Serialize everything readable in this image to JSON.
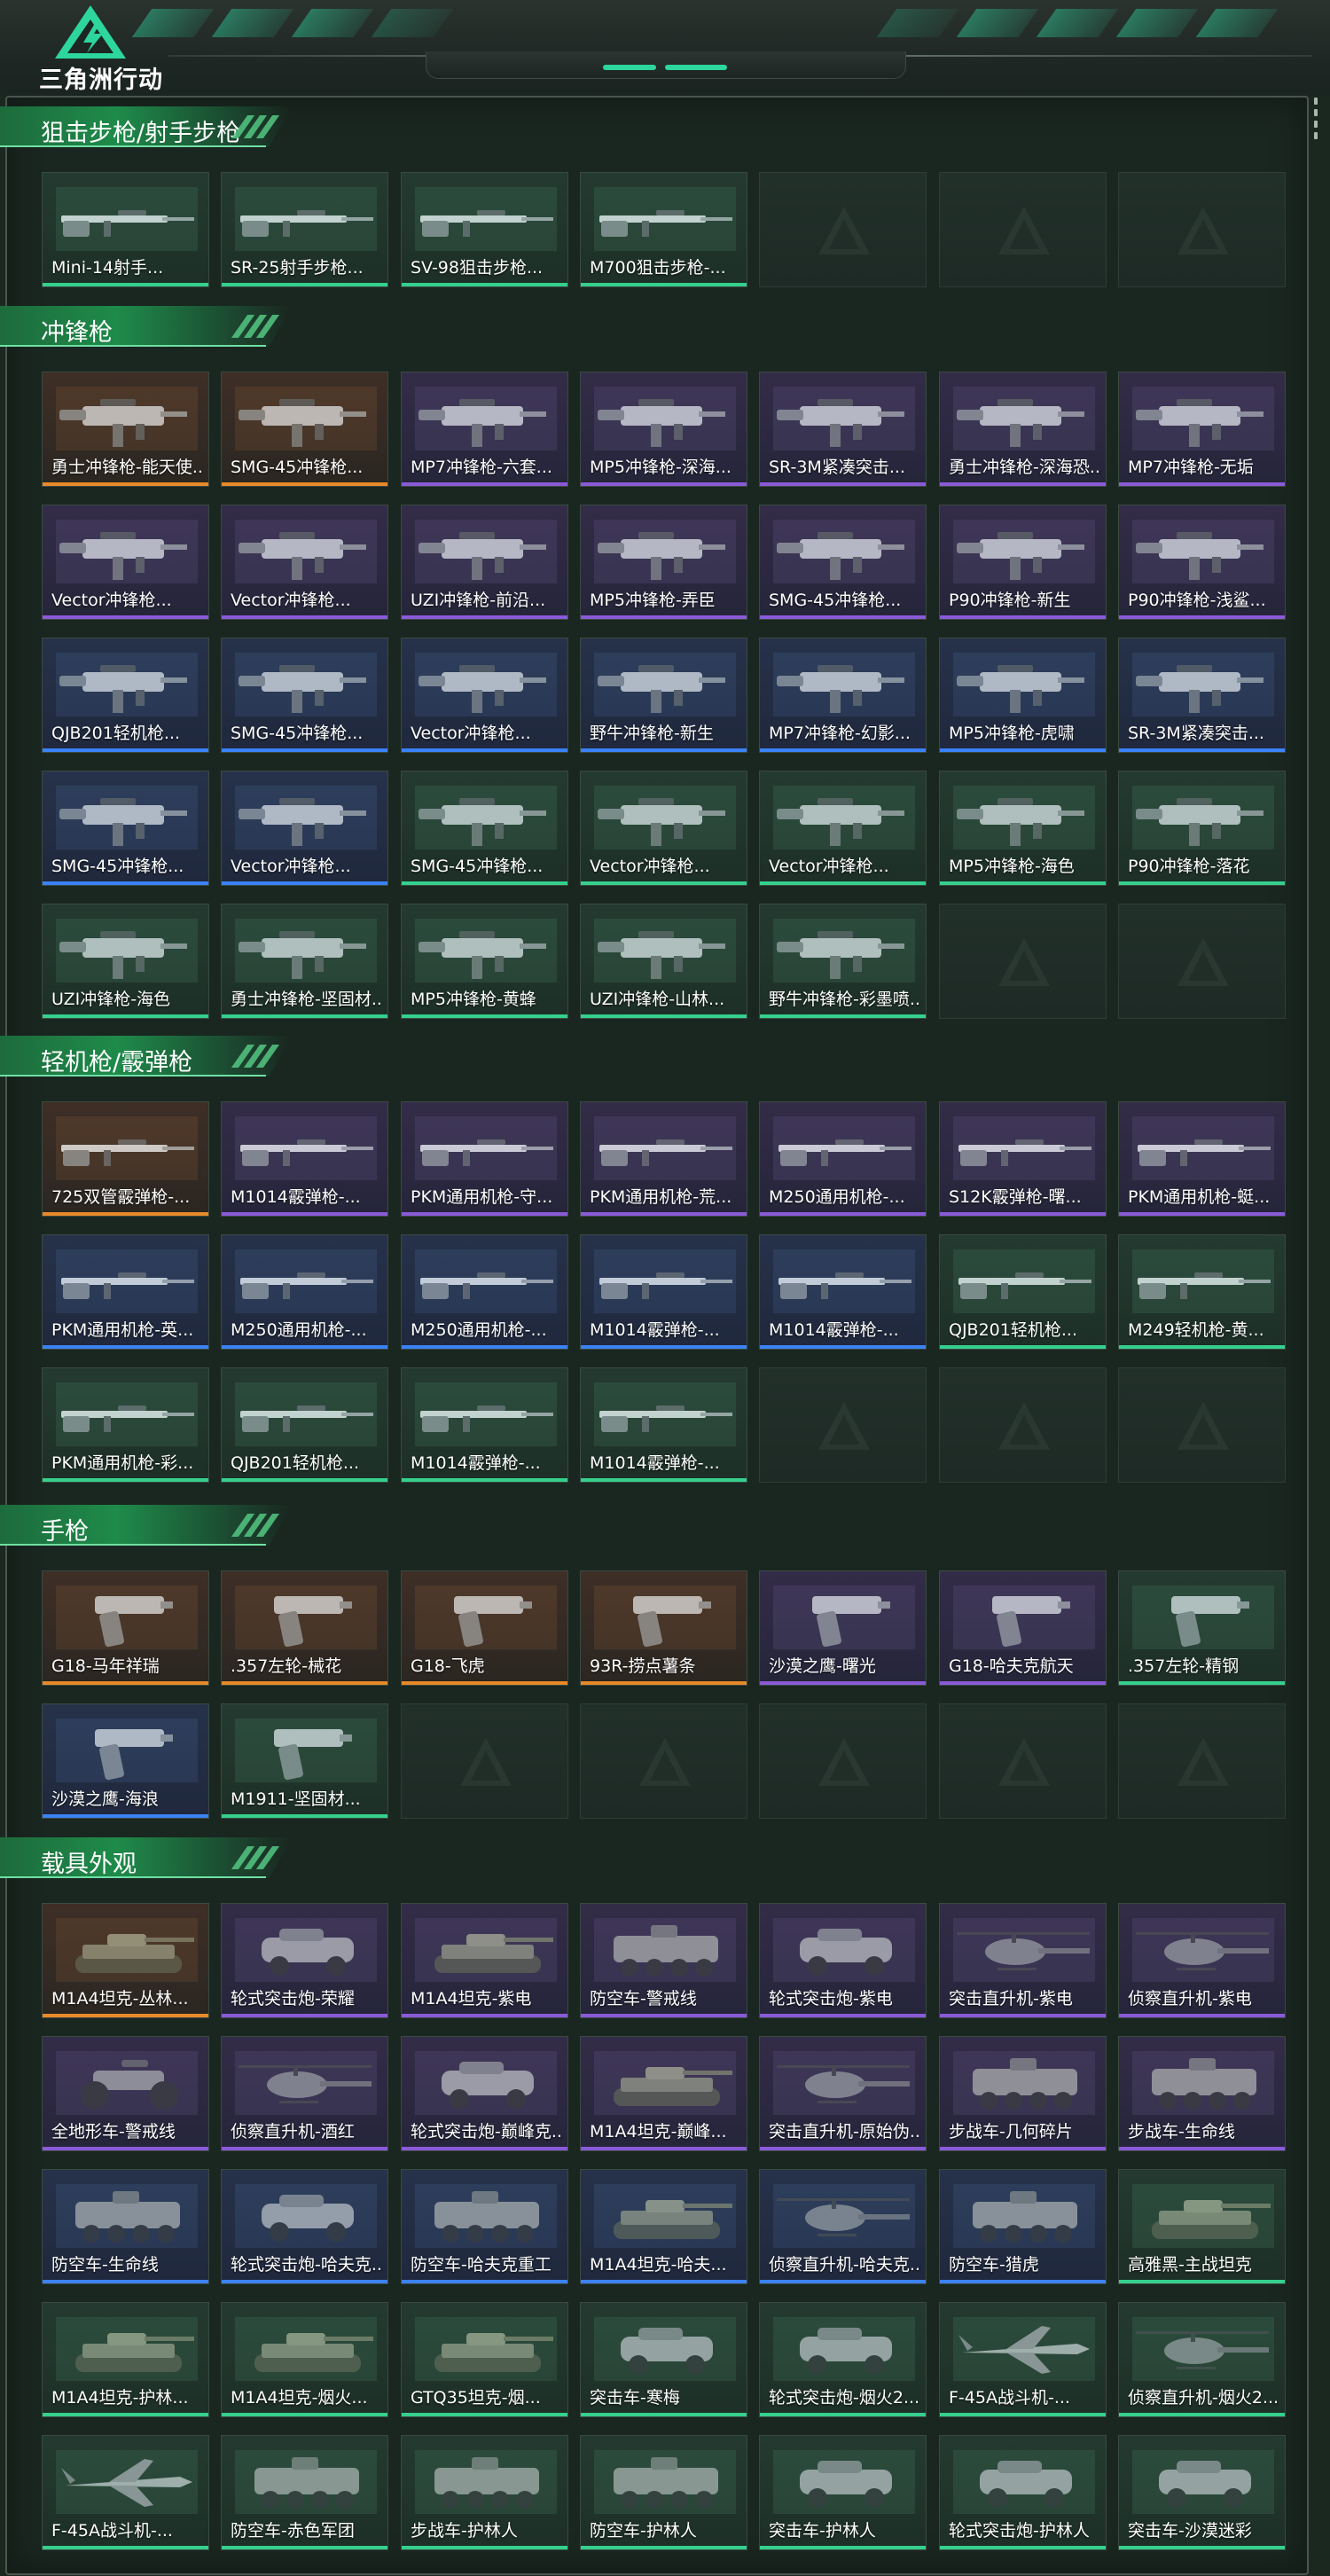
{
  "header": {
    "game_logo_text": "三角洲行动",
    "accent_color": "#2dd69d"
  },
  "rarity_colors": {
    "orange": "#e88a2a",
    "purple": "#8a5ad8",
    "blue": "#3b82f6",
    "green": "#35d08e"
  },
  "sections": [
    {
      "title": "狙击步枪/射手步枪",
      "items": [
        {
          "name": "Mini-14射手...",
          "rarity": "green",
          "type": "rifle"
        },
        {
          "name": "SR-25射手步枪...",
          "rarity": "green",
          "type": "rifle"
        },
        {
          "name": "SV-98狙击步枪...",
          "rarity": "green",
          "type": "rifle"
        },
        {
          "name": "M700狙击步枪-...",
          "rarity": "green",
          "type": "rifle"
        }
      ],
      "empty_slots": 3
    },
    {
      "title": "冲锋枪",
      "items": [
        {
          "name": "勇士冲锋枪-能天使...",
          "rarity": "orange",
          "type": "smg"
        },
        {
          "name": "SMG-45冲锋枪...",
          "rarity": "orange",
          "type": "smg"
        },
        {
          "name": "MP7冲锋枪-六套...",
          "rarity": "purple",
          "type": "smg"
        },
        {
          "name": "MP5冲锋枪-深海...",
          "rarity": "purple",
          "type": "smg"
        },
        {
          "name": "SR-3M紧凑突击...",
          "rarity": "purple",
          "type": "smg"
        },
        {
          "name": "勇士冲锋枪-深海恐...",
          "rarity": "purple",
          "type": "smg"
        },
        {
          "name": "MP7冲锋枪-无垢",
          "rarity": "purple",
          "type": "smg"
        },
        {
          "name": "Vector冲锋枪...",
          "rarity": "purple",
          "type": "smg"
        },
        {
          "name": "Vector冲锋枪...",
          "rarity": "purple",
          "type": "smg"
        },
        {
          "name": "UZI冲锋枪-前沿...",
          "rarity": "purple",
          "type": "smg"
        },
        {
          "name": "MP5冲锋枪-弄臣",
          "rarity": "purple",
          "type": "smg"
        },
        {
          "name": "SMG-45冲锋枪...",
          "rarity": "purple",
          "type": "smg"
        },
        {
          "name": "P90冲锋枪-新生",
          "rarity": "purple",
          "type": "smg"
        },
        {
          "name": "P90冲锋枪-浅鲨...",
          "rarity": "purple",
          "type": "smg"
        },
        {
          "name": "QJB201轻机枪...",
          "rarity": "blue",
          "type": "smg"
        },
        {
          "name": "SMG-45冲锋枪...",
          "rarity": "blue",
          "type": "smg"
        },
        {
          "name": "Vector冲锋枪...",
          "rarity": "blue",
          "type": "smg"
        },
        {
          "name": "野牛冲锋枪-新生",
          "rarity": "blue",
          "type": "smg"
        },
        {
          "name": "MP7冲锋枪-幻影...",
          "rarity": "blue",
          "type": "smg"
        },
        {
          "name": "MP5冲锋枪-虎啸",
          "rarity": "blue",
          "type": "smg"
        },
        {
          "name": "SR-3M紧凑突击...",
          "rarity": "blue",
          "type": "smg"
        },
        {
          "name": "SMG-45冲锋枪...",
          "rarity": "blue",
          "type": "smg"
        },
        {
          "name": "Vector冲锋枪...",
          "rarity": "blue",
          "type": "smg"
        },
        {
          "name": "SMG-45冲锋枪...",
          "rarity": "green",
          "type": "smg"
        },
        {
          "name": "Vector冲锋枪...",
          "rarity": "green",
          "type": "smg"
        },
        {
          "name": "Vector冲锋枪...",
          "rarity": "green",
          "type": "smg"
        },
        {
          "name": "MP5冲锋枪-海色",
          "rarity": "green",
          "type": "smg"
        },
        {
          "name": "P90冲锋枪-落花",
          "rarity": "green",
          "type": "smg"
        },
        {
          "name": "UZI冲锋枪-海色",
          "rarity": "green",
          "type": "smg"
        },
        {
          "name": "勇士冲锋枪-坚固材...",
          "rarity": "green",
          "type": "smg"
        },
        {
          "name": "MP5冲锋枪-黄蜂",
          "rarity": "green",
          "type": "smg"
        },
        {
          "name": "UZI冲锋枪-山林...",
          "rarity": "green",
          "type": "smg"
        },
        {
          "name": "野牛冲锋枪-彩墨喷...",
          "rarity": "green",
          "type": "smg"
        }
      ],
      "empty_slots": 2
    },
    {
      "title": "轻机枪/霰弹枪",
      "items": [
        {
          "name": "725双管霰弹枪-...",
          "rarity": "orange",
          "type": "rifle"
        },
        {
          "name": "M1014霰弹枪-...",
          "rarity": "purple",
          "type": "rifle"
        },
        {
          "name": "PKM通用机枪-守...",
          "rarity": "purple",
          "type": "rifle"
        },
        {
          "name": "PKM通用机枪-荒...",
          "rarity": "purple",
          "type": "rifle"
        },
        {
          "name": "M250通用机枪-...",
          "rarity": "purple",
          "type": "rifle"
        },
        {
          "name": "S12K霰弹枪-曙...",
          "rarity": "purple",
          "type": "rifle"
        },
        {
          "name": "PKM通用机枪-蜓...",
          "rarity": "purple",
          "type": "rifle"
        },
        {
          "name": "PKM通用机枪-英...",
          "rarity": "blue",
          "type": "rifle"
        },
        {
          "name": "M250通用机枪-...",
          "rarity": "blue",
          "type": "rifle"
        },
        {
          "name": "M250通用机枪-...",
          "rarity": "blue",
          "type": "rifle"
        },
        {
          "name": "M1014霰弹枪-...",
          "rarity": "blue",
          "type": "rifle"
        },
        {
          "name": "M1014霰弹枪-...",
          "rarity": "blue",
          "type": "rifle"
        },
        {
          "name": "QJB201轻机枪...",
          "rarity": "green",
          "type": "rifle"
        },
        {
          "name": "M249轻机枪-黄...",
          "rarity": "green",
          "type": "rifle"
        },
        {
          "name": "PKM通用机枪-彩...",
          "rarity": "green",
          "type": "rifle"
        },
        {
          "name": "QJB201轻机枪...",
          "rarity": "green",
          "type": "rifle"
        },
        {
          "name": "M1014霰弹枪-...",
          "rarity": "green",
          "type": "rifle"
        },
        {
          "name": "M1014霰弹枪-...",
          "rarity": "green",
          "type": "rifle"
        }
      ],
      "empty_slots": 3
    },
    {
      "title": "手枪",
      "items": [
        {
          "name": "G18-马年祥瑞",
          "rarity": "orange",
          "type": "pistol"
        },
        {
          "name": ".357左轮-械花",
          "rarity": "orange",
          "type": "pistol"
        },
        {
          "name": "G18-飞虎",
          "rarity": "orange",
          "type": "pistol"
        },
        {
          "name": "93R-捞点薯条",
          "rarity": "orange",
          "type": "pistol"
        },
        {
          "name": "沙漠之鹰-曙光",
          "rarity": "purple",
          "type": "pistol"
        },
        {
          "name": "G18-哈夫克航天",
          "rarity": "purple",
          "type": "pistol"
        },
        {
          "name": ".357左轮-精钢",
          "rarity": "green",
          "type": "pistol"
        },
        {
          "name": "沙漠之鹰-海浪",
          "rarity": "blue",
          "type": "pistol"
        },
        {
          "name": "M1911-坚固材...",
          "rarity": "green",
          "type": "pistol"
        }
      ],
      "empty_slots": 5
    },
    {
      "title": "载具外观",
      "items": [
        {
          "name": "M1A4坦克-丛林...",
          "rarity": "orange",
          "type": "tank"
        },
        {
          "name": "轮式突击炮-荣耀",
          "rarity": "purple",
          "type": "car"
        },
        {
          "name": "M1A4坦克-紫电",
          "rarity": "purple",
          "type": "tank"
        },
        {
          "name": "防空车-警戒线",
          "rarity": "purple",
          "type": "apc"
        },
        {
          "name": "轮式突击炮-紫电",
          "rarity": "purple",
          "type": "car"
        },
        {
          "name": "突击直升机-紫电",
          "rarity": "purple",
          "type": "heli"
        },
        {
          "name": "侦察直升机-紫电",
          "rarity": "purple",
          "type": "heli"
        },
        {
          "name": "全地形车-警戒线",
          "rarity": "purple",
          "type": "atv"
        },
        {
          "name": "侦察直升机-酒红",
          "rarity": "purple",
          "type": "heli"
        },
        {
          "name": "轮式突击炮-巅峰克...",
          "rarity": "purple",
          "type": "car"
        },
        {
          "name": "M1A4坦克-巅峰...",
          "rarity": "purple",
          "type": "tank"
        },
        {
          "name": "突击直升机-原始伪...",
          "rarity": "purple",
          "type": "heli"
        },
        {
          "name": "步战车-几何碎片",
          "rarity": "purple",
          "type": "apc"
        },
        {
          "name": "步战车-生命线",
          "rarity": "purple",
          "type": "apc"
        },
        {
          "name": "防空车-生命线",
          "rarity": "blue",
          "type": "apc"
        },
        {
          "name": "轮式突击炮-哈夫克...",
          "rarity": "blue",
          "type": "car"
        },
        {
          "name": "防空车-哈夫克重工",
          "rarity": "blue",
          "type": "apc"
        },
        {
          "name": "M1A4坦克-哈夫...",
          "rarity": "blue",
          "type": "tank"
        },
        {
          "name": "侦察直升机-哈夫克...",
          "rarity": "blue",
          "type": "heli"
        },
        {
          "name": "防空车-猎虎",
          "rarity": "blue",
          "type": "apc"
        },
        {
          "name": "高雅黑-主战坦克",
          "rarity": "green",
          "type": "tank"
        },
        {
          "name": "M1A4坦克-护林...",
          "rarity": "green",
          "type": "tank"
        },
        {
          "name": "M1A4坦克-烟火...",
          "rarity": "green",
          "type": "tank"
        },
        {
          "name": "GTQ35坦克-烟...",
          "rarity": "green",
          "type": "tank"
        },
        {
          "name": "突击车-寒梅",
          "rarity": "green",
          "type": "car"
        },
        {
          "name": "轮式突击炮-烟火2...",
          "rarity": "green",
          "type": "car"
        },
        {
          "name": "F-45A战斗机-...",
          "rarity": "green",
          "type": "jet"
        },
        {
          "name": "侦察直升机-烟火2...",
          "rarity": "green",
          "type": "heli"
        },
        {
          "name": "F-45A战斗机-...",
          "rarity": "green",
          "type": "jet"
        },
        {
          "name": "防空车-赤色军团",
          "rarity": "green",
          "type": "apc"
        },
        {
          "name": "步战车-护林人",
          "rarity": "green",
          "type": "apc"
        },
        {
          "name": "防空车-护林人",
          "rarity": "green",
          "type": "apc"
        },
        {
          "name": "突击车-护林人",
          "rarity": "green",
          "type": "car"
        },
        {
          "name": "轮式突击炮-护林人",
          "rarity": "green",
          "type": "car"
        },
        {
          "name": "突击车-沙漠迷彩",
          "rarity": "green",
          "type": "car"
        }
      ],
      "empty_slots": 0
    }
  ]
}
